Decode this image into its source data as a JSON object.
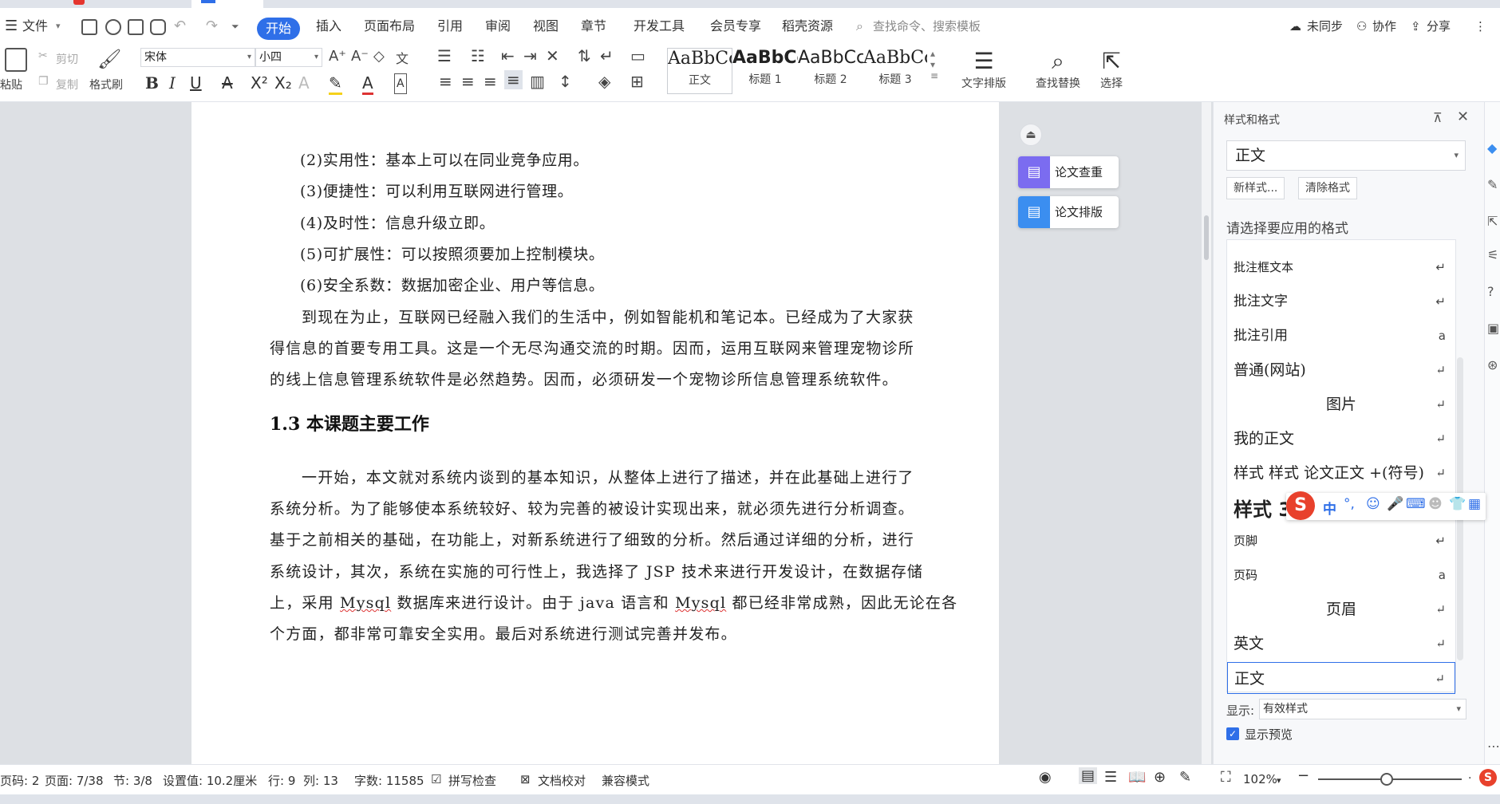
{
  "menubar": {
    "file": "文件",
    "tabs": [
      "开始",
      "插入",
      "页面布局",
      "引用",
      "审阅",
      "视图",
      "章节",
      "开发工具",
      "会员专享",
      "稻壳资源"
    ],
    "search_placeholder": "查找命令、搜索模板",
    "sync": "未同步",
    "collab": "协作",
    "share": "分享"
  },
  "ribbon": {
    "paste": "粘贴",
    "cut": "剪切",
    "copy": "复制",
    "format_painter": "格式刷",
    "font_name": "宋体",
    "font_size": "小四",
    "styles": [
      {
        "sample": "AaBbCcI",
        "label": "正文"
      },
      {
        "sample": "AaBbCcI",
        "label": "标题 1"
      },
      {
        "sample": "AaBbCcI",
        "label": "标题 2"
      },
      {
        "sample": "AaBbCc",
        "label": "标题 3"
      }
    ],
    "text_layout": "文字排版",
    "find_replace": "查找替换",
    "select": "选择"
  },
  "document": {
    "lines": [
      "(2)实用性：基本上可以在同业竞争应用。",
      "(3)便捷性：可以利用互联网进行管理。",
      "(4)及时性：信息升级立即。",
      "(5)可扩展性：可以按照须要加上控制模块。",
      "(6)安全系数：数据加密企业、用户等信息。"
    ],
    "para1": [
      "到现在为止，互联网已经融入我们的生活中，例如智能机和笔记本。已经成为了大家获",
      "得信息的首要专用工具。这是一个无尽沟通交流的时期。因而，运用互联网来管理宠物诊所",
      "的线上信息管理系统软件是必然趋势。因而，必须研发一个宠物诊所信息管理系统软件。"
    ],
    "heading": "1.3  本课题主要工作",
    "para2": [
      "一开始，本文就对系统内谈到的基本知识，从整体上进行了描述，并在此基础上进行了",
      "系统分析。为了能够使本系统较好、较为完善的被设计实现出来，就必须先进行分析调查。",
      "基于之前相关的基础，在功能上，对新系统进行了细致的分析。然后通过详细的分析，进行",
      "系统设计，其次，系统在实施的可行性上，我选择了 JSP 技术来进行开发设计，在数据存储"
    ],
    "para2_l5": {
      "a": "上，采用 ",
      "b": "Mysql",
      "c": " 数据库来进行设计。由于 java 语言和 ",
      "d": "Mysql",
      "e": " 都已经非常成熟，因此无论在各"
    },
    "para2_l6": "个方面，都非常可靠安全实用。最后对系统进行测试完善并发布。"
  },
  "float_tools": {
    "check": "论文查重",
    "layout": "论文排版"
  },
  "panel": {
    "title": "样式和格式",
    "current_style": "正文",
    "new_style": "新样式...",
    "clear_format": "清除格式",
    "subtitle": "请选择要应用的格式",
    "items": [
      {
        "label": "批注框文本",
        "mark": "↵"
      },
      {
        "label": "批注文字",
        "mark": "↵"
      },
      {
        "label": "批注引用",
        "mark": "a"
      },
      {
        "label": "普通(网站)",
        "mark": "↵"
      },
      {
        "label": "图片",
        "mark": "↵"
      },
      {
        "label": "我的正文",
        "mark": "↵"
      },
      {
        "label": "样式 样式 论文正文 +(符号)",
        "mark": "↵"
      },
      {
        "label": "样式 3",
        "mark": ""
      },
      {
        "label": "页脚",
        "mark": "↵"
      },
      {
        "label": "页码",
        "mark": "a"
      },
      {
        "label": "页眉",
        "mark": "↵"
      },
      {
        "label": "英文",
        "mark": "↵"
      },
      {
        "label": "正文",
        "mark": "↵"
      }
    ],
    "show_label": "显示:",
    "show_value": "有效样式",
    "preview_label": "显示预览"
  },
  "ime": {
    "lang": "中",
    "punct": "°,"
  },
  "status": {
    "page_no": "页码: 2",
    "page": "页面: 7/38",
    "section": "节: 3/8",
    "setting": "设置值: 10.2厘米",
    "row": "行: 9",
    "col": "列: 13",
    "words": "字数: 11585",
    "spell": "拼写检查",
    "proof": "文档校对",
    "compat": "兼容模式",
    "zoom": "102%"
  },
  "colors": {
    "accent": "#2f6fe8",
    "ime_logo": "#e8412c"
  }
}
